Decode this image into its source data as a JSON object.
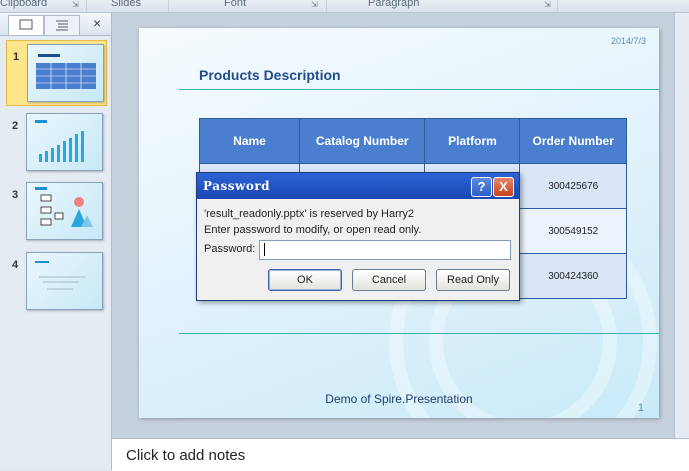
{
  "ribbon": {
    "groups": [
      "Clipboard",
      "Slides",
      "Font",
      "Paragraph"
    ]
  },
  "panel": {
    "close": "×",
    "thumbnails": [
      {
        "num": "1"
      },
      {
        "num": "2"
      },
      {
        "num": "3"
      },
      {
        "num": "4"
      }
    ]
  },
  "slide": {
    "date": "2014/7/3",
    "title": "Products Description",
    "table": {
      "headers": [
        "Name",
        "Catalog Number",
        "Platform",
        "Order Number"
      ],
      "rows": [
        [
          "",
          "",
          "",
          "300425676"
        ],
        [
          "",
          "",
          "",
          "300549152"
        ],
        [
          "",
          "",
          "",
          "300424360"
        ]
      ]
    },
    "footer": "Demo of Spire.Presentation",
    "page_number": "1"
  },
  "notes": {
    "placeholder": "Click to add notes"
  },
  "dialog": {
    "title": "Password",
    "help": "?",
    "close": "X",
    "message1": "'result_readonly.pptx' is reserved by Harry2",
    "message2": "Enter password to modify, or open read only.",
    "password_label": "Password:",
    "buttons": {
      "ok": "OK",
      "cancel": "Cancel",
      "read_only": "Read Only"
    }
  }
}
